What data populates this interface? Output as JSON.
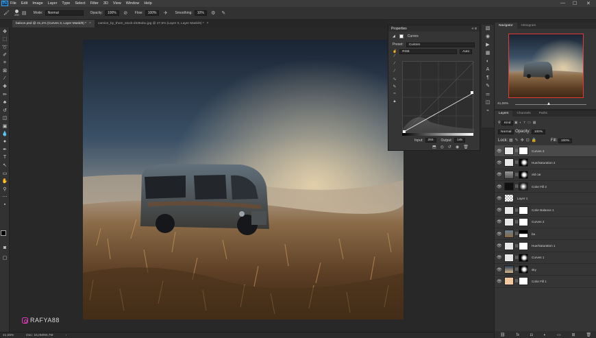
{
  "menu": {
    "items": [
      "File",
      "Edit",
      "Image",
      "Layer",
      "Type",
      "Select",
      "Filter",
      "3D",
      "View",
      "Window",
      "Help"
    ],
    "ps_logo": "Ps",
    "window_controls": [
      "—",
      "☐",
      "✕"
    ]
  },
  "options": {
    "brush_size": "250",
    "mode_label": "Mode:",
    "mode_value": "Normal",
    "opacity_label": "Opacity:",
    "opacity_value": "100%",
    "flow_label": "Flow:",
    "flow_value": "100%",
    "smoothing_label": "Smoothing:",
    "smoothing_value": "10%"
  },
  "tabs": [
    {
      "label": "baloon.psd @ 41,1% (Curves 3, Layer Mask/8) *",
      "close": "×"
    },
    {
      "label": "camion_by_thom_stock-d436obu.jpg @ 27,5% (Layer 0, Layer Mask/8) *",
      "close": "×"
    }
  ],
  "status": {
    "zoom": "41,06%",
    "doc": "Doc: 15,0M/93,7M",
    "arrow": "›"
  },
  "watermark": {
    "handle": "RAFYA88"
  },
  "properties": {
    "tab_label": "Properties",
    "panel_controls": "‹‹  ≡",
    "adjustment_name": "Curves",
    "preset_label": "Preset:",
    "preset_value": "Custom",
    "channel_value": "RGB",
    "auto_label": "Auto",
    "input_label": "Input:",
    "input_value": "255",
    "output_label": "Output:",
    "output_value": "145"
  },
  "navigator": {
    "tabs": [
      "Navigator",
      "Histogram"
    ],
    "zoom": "41,06%"
  },
  "layers_panel": {
    "tabs": [
      "Layers",
      "Channels",
      "Paths"
    ],
    "kind_label": "Kind",
    "blend_mode": "Normal",
    "opacity_label": "Opacity:",
    "opacity_value": "100%",
    "lock_label": "Lock:",
    "fill_label": "Fill:",
    "fill_value": "100%",
    "layers": [
      {
        "name": "Curves 3",
        "thumb": "adj",
        "mask": "white",
        "selected": true
      },
      {
        "name": "Hue/Saturation 2",
        "thumb": "adj",
        "mask": "dark",
        "selected": false
      },
      {
        "name": "old car",
        "thumb": "car",
        "mask": "dark",
        "selected": false
      },
      {
        "name": "Color Fill 2",
        "thumb": "black",
        "mask": "glow",
        "selected": false
      },
      {
        "name": "Layer 1",
        "thumb": "checker",
        "mask": "none",
        "selected": false
      },
      {
        "name": "Color Balance 1",
        "thumb": "adj",
        "mask": "white",
        "selected": false
      },
      {
        "name": "Curves 2",
        "thumb": "adj",
        "mask": "white",
        "selected": false
      },
      {
        "name": "ba",
        "thumb": "photo",
        "mask": "half",
        "selected": false
      },
      {
        "name": "Hue/Saturation 1",
        "thumb": "adj",
        "mask": "white",
        "selected": false
      },
      {
        "name": "Curves 1",
        "thumb": "adj",
        "mask": "dark",
        "selected": false
      },
      {
        "name": "sky",
        "thumb": "sky",
        "mask": "dark",
        "selected": false
      },
      {
        "name": "Color Fill 1",
        "thumb": "peach",
        "mask": "white",
        "selected": false
      }
    ],
    "footer_icons": [
      "link-icon",
      "fx-icon",
      "mask-icon",
      "adjustment-icon",
      "group-icon",
      "new-layer-icon",
      "trash-icon"
    ],
    "footer_glyphs": [
      "⛓",
      "fx",
      "◘",
      "◐",
      "▭",
      "⊞",
      "🗑"
    ]
  },
  "colors": {
    "accent_blue": "#31a8ff",
    "nav_frame": "#e53935"
  }
}
